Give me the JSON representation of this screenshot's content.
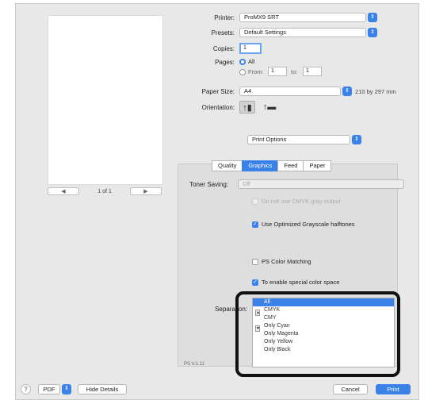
{
  "preview": {
    "prev_glyph": "◀",
    "next_glyph": "▶",
    "page_counter": "1 of 1"
  },
  "printer": {
    "label": "Printer:",
    "value": "ProMX9 SRT"
  },
  "presets": {
    "label": "Presets:",
    "value": "Default Settings"
  },
  "copies": {
    "label": "Copies:",
    "value": "1"
  },
  "pages": {
    "label": "Pages:",
    "all_label": "All",
    "from_label": "From:",
    "from_value": "1",
    "to_label": "to:",
    "to_value": "1"
  },
  "paper_size": {
    "label": "Paper Size:",
    "value": "A4",
    "dimensions": "210 by 297 mm"
  },
  "orientation": {
    "label": "Orientation:",
    "portrait_glyph": "↑▮",
    "landscape_glyph": "↑▬"
  },
  "section_popup": {
    "value": "Print Options"
  },
  "tabs": [
    "Quality",
    "Graphics",
    "Feed",
    "Paper"
  ],
  "options": {
    "toner_saving_label": "Toner Saving:",
    "toner_saving_value": "Off",
    "grayed_option": "Do not use CMYK gray output",
    "optimized_label": "Use Optimized Grayscale halftones",
    "ps_color_label": "PS Color Matching",
    "cmyk_label": "To enable special color space",
    "separation_label": "Separation:",
    "separation_items": [
      "All",
      "CMYK",
      "CMY",
      "Only Cyan",
      "Only Magenta",
      "Only Yellow",
      "Only Black"
    ],
    "version": "PS V.1.11"
  },
  "bottom": {
    "help": "?",
    "pdf_label": "PDF",
    "hide_details": "Hide Details",
    "cancel": "Cancel",
    "print": "Print"
  },
  "colors": {
    "accent": "#3b82e8",
    "highlight_outline": "#111111"
  },
  "icons": {
    "stepper": "chevron-updown-icon",
    "checkmark": "checkmark-icon"
  }
}
